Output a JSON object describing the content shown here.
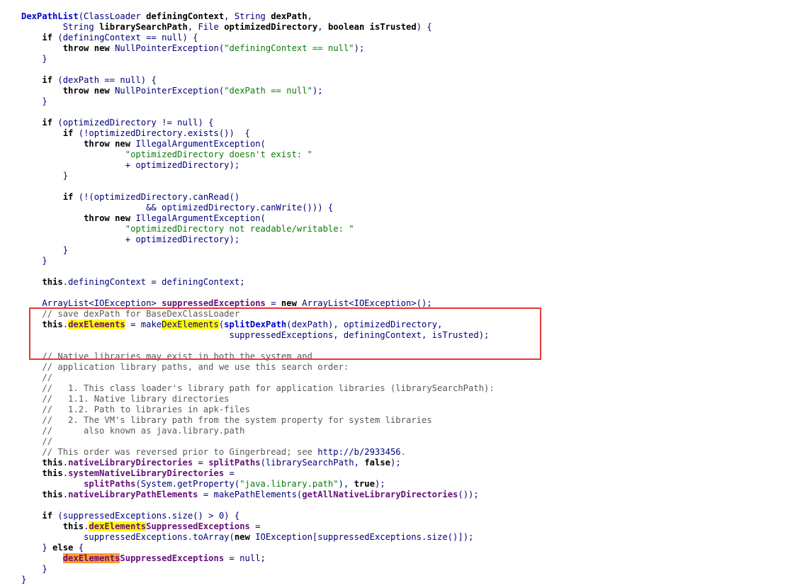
{
  "lines": [
    [
      {
        "t": "DexPathList",
        "c": "fn"
      },
      {
        "t": "(ClassLoader ",
        "c": "pl"
      },
      {
        "t": "definingContext",
        "c": "kw"
      },
      {
        "t": ", String ",
        "c": "pl"
      },
      {
        "t": "dexPath",
        "c": "kw"
      },
      {
        "t": ",",
        "c": "pl"
      }
    ],
    [
      {
        "t": "        String ",
        "c": "pl"
      },
      {
        "t": "librarySearchPath",
        "c": "kw"
      },
      {
        "t": ", File ",
        "c": "pl"
      },
      {
        "t": "optimizedDirectory",
        "c": "kw"
      },
      {
        "t": ", ",
        "c": "pl"
      },
      {
        "t": "boolean",
        "c": "kw"
      },
      {
        "t": " ",
        "c": "pl"
      },
      {
        "t": "isTrusted",
        "c": "kw"
      },
      {
        "t": ") {",
        "c": "pl"
      }
    ],
    [
      {
        "t": "    ",
        "c": "pl"
      },
      {
        "t": "if",
        "c": "kw"
      },
      {
        "t": " (definingContext == null) {",
        "c": "pl"
      }
    ],
    [
      {
        "t": "        ",
        "c": "pl"
      },
      {
        "t": "throw",
        "c": "kw"
      },
      {
        "t": " ",
        "c": "pl"
      },
      {
        "t": "new",
        "c": "kw"
      },
      {
        "t": " NullPointerException(",
        "c": "pl"
      },
      {
        "t": "\"definingContext == null\"",
        "c": "st"
      },
      {
        "t": ");",
        "c": "pl"
      }
    ],
    [
      {
        "t": "    }",
        "c": "pl"
      }
    ],
    [],
    [
      {
        "t": "    ",
        "c": "pl"
      },
      {
        "t": "if",
        "c": "kw"
      },
      {
        "t": " (dexPath == null) {",
        "c": "pl"
      }
    ],
    [
      {
        "t": "        ",
        "c": "pl"
      },
      {
        "t": "throw",
        "c": "kw"
      },
      {
        "t": " ",
        "c": "pl"
      },
      {
        "t": "new",
        "c": "kw"
      },
      {
        "t": " NullPointerException(",
        "c": "pl"
      },
      {
        "t": "\"dexPath == null\"",
        "c": "st"
      },
      {
        "t": ");",
        "c": "pl"
      }
    ],
    [
      {
        "t": "    }",
        "c": "pl"
      }
    ],
    [],
    [
      {
        "t": "    ",
        "c": "pl"
      },
      {
        "t": "if",
        "c": "kw"
      },
      {
        "t": " (optimizedDirectory != null) {",
        "c": "pl"
      }
    ],
    [
      {
        "t": "        ",
        "c": "pl"
      },
      {
        "t": "if",
        "c": "kw"
      },
      {
        "t": " (!optimizedDirectory.exists())  {",
        "c": "pl"
      }
    ],
    [
      {
        "t": "            ",
        "c": "pl"
      },
      {
        "t": "throw",
        "c": "kw"
      },
      {
        "t": " ",
        "c": "pl"
      },
      {
        "t": "new",
        "c": "kw"
      },
      {
        "t": " IllegalArgumentException(",
        "c": "pl"
      }
    ],
    [
      {
        "t": "                    ",
        "c": "pl"
      },
      {
        "t": "\"optimizedDirectory doesn't exist: \"",
        "c": "st"
      }
    ],
    [
      {
        "t": "                    + optimizedDirectory);",
        "c": "pl"
      }
    ],
    [
      {
        "t": "        }",
        "c": "pl"
      }
    ],
    [],
    [
      {
        "t": "        ",
        "c": "pl"
      },
      {
        "t": "if",
        "c": "kw"
      },
      {
        "t": " (!(optimizedDirectory.canRead()",
        "c": "pl"
      }
    ],
    [
      {
        "t": "                        && optimizedDirectory.canWrite())) {",
        "c": "pl"
      }
    ],
    [
      {
        "t": "            ",
        "c": "pl"
      },
      {
        "t": "throw",
        "c": "kw"
      },
      {
        "t": " ",
        "c": "pl"
      },
      {
        "t": "new",
        "c": "kw"
      },
      {
        "t": " IllegalArgumentException(",
        "c": "pl"
      }
    ],
    [
      {
        "t": "                    ",
        "c": "pl"
      },
      {
        "t": "\"optimizedDirectory not readable/writable: \"",
        "c": "st"
      }
    ],
    [
      {
        "t": "                    + optimizedDirectory);",
        "c": "pl"
      }
    ],
    [
      {
        "t": "        }",
        "c": "pl"
      }
    ],
    [
      {
        "t": "    }",
        "c": "pl"
      }
    ],
    [],
    [
      {
        "t": "    ",
        "c": "pl"
      },
      {
        "t": "this",
        "c": "kw"
      },
      {
        "t": ".definingContext = definingContext;",
        "c": "pl"
      }
    ],
    [],
    [
      {
        "t": "    ArrayList<IOException> ",
        "c": "pl"
      },
      {
        "t": "suppressedExceptions",
        "c": "fd"
      },
      {
        "t": " = ",
        "c": "pl"
      },
      {
        "t": "new",
        "c": "kw"
      },
      {
        "t": " ArrayList<IOException>();",
        "c": "pl"
      }
    ],
    [
      {
        "t": "    // save dexPath for BaseDexClassLoader",
        "c": "cm"
      }
    ],
    [
      {
        "t": "    ",
        "c": "pl"
      },
      {
        "t": "this",
        "c": "kw"
      },
      {
        "t": ".",
        "c": "pl"
      },
      {
        "t": "dexElements",
        "c": "fd",
        "h": "y"
      },
      {
        "t": " = make",
        "c": "pl"
      },
      {
        "t": "DexElements",
        "c": "pl",
        "h": "y"
      },
      {
        "t": "(",
        "c": "pl"
      },
      {
        "t": "splitDexPath",
        "c": "fn"
      },
      {
        "t": "(dexPath), optimizedDirectory,",
        "c": "pl"
      }
    ],
    [
      {
        "t": "                                        suppressedExceptions, definingContext, isTrusted);",
        "c": "pl"
      }
    ],
    [],
    [
      {
        "t": "    // Native libraries may exist in both the system and",
        "c": "cm"
      }
    ],
    [
      {
        "t": "    // application library paths, and we use this search order:",
        "c": "cm"
      }
    ],
    [
      {
        "t": "    //",
        "c": "cm"
      }
    ],
    [
      {
        "t": "    //   1. This class loader's library path for application libraries (librarySearchPath):",
        "c": "cm"
      }
    ],
    [
      {
        "t": "    //   1.1. Native library directories",
        "c": "cm"
      }
    ],
    [
      {
        "t": "    //   1.2. Path to libraries in apk-files",
        "c": "cm"
      }
    ],
    [
      {
        "t": "    //   2. The VM's library path from the system property for system libraries",
        "c": "cm"
      }
    ],
    [
      {
        "t": "    //      also known as java.library.path",
        "c": "cm"
      }
    ],
    [
      {
        "t": "    //",
        "c": "cm"
      }
    ],
    [
      {
        "t": "    // This order was reversed prior to Gingerbread; see ",
        "c": "cm"
      },
      {
        "t": "http://b/2933456",
        "c": "pl"
      },
      {
        "t": ".",
        "c": "cm"
      }
    ],
    [
      {
        "t": "    ",
        "c": "pl"
      },
      {
        "t": "this",
        "c": "kw"
      },
      {
        "t": ".",
        "c": "pl"
      },
      {
        "t": "nativeLibraryDirectories",
        "c": "fd"
      },
      {
        "t": " = ",
        "c": "pl"
      },
      {
        "t": "splitPaths",
        "c": "fd"
      },
      {
        "t": "(librarySearchPath, ",
        "c": "pl"
      },
      {
        "t": "false",
        "c": "kw"
      },
      {
        "t": ");",
        "c": "pl"
      }
    ],
    [
      {
        "t": "    ",
        "c": "pl"
      },
      {
        "t": "this",
        "c": "kw"
      },
      {
        "t": ".",
        "c": "pl"
      },
      {
        "t": "systemNativeLibraryDirectories",
        "c": "fd"
      },
      {
        "t": " =",
        "c": "pl"
      }
    ],
    [
      {
        "t": "            ",
        "c": "pl"
      },
      {
        "t": "splitPaths",
        "c": "fd"
      },
      {
        "t": "(System.getProperty(",
        "c": "pl"
      },
      {
        "t": "\"java.library.path\"",
        "c": "st"
      },
      {
        "t": "), ",
        "c": "pl"
      },
      {
        "t": "true",
        "c": "kw"
      },
      {
        "t": ");",
        "c": "pl"
      }
    ],
    [
      {
        "t": "    ",
        "c": "pl"
      },
      {
        "t": "this",
        "c": "kw"
      },
      {
        "t": ".",
        "c": "pl"
      },
      {
        "t": "nativeLibraryPathElements",
        "c": "fd"
      },
      {
        "t": " = makePathElements(",
        "c": "pl"
      },
      {
        "t": "getAllNativeLibraryDirectories",
        "c": "fd"
      },
      {
        "t": "());",
        "c": "pl"
      }
    ],
    [],
    [
      {
        "t": "    ",
        "c": "pl"
      },
      {
        "t": "if",
        "c": "kw"
      },
      {
        "t": " (suppressedExceptions.size() > 0) {",
        "c": "pl"
      }
    ],
    [
      {
        "t": "        ",
        "c": "pl"
      },
      {
        "t": "this",
        "c": "kw"
      },
      {
        "t": ".",
        "c": "pl"
      },
      {
        "t": "dexElements",
        "c": "fd",
        "h": "y"
      },
      {
        "t": "SuppressedExceptions",
        "c": "fd"
      },
      {
        "t": " =",
        "c": "pl"
      }
    ],
    [
      {
        "t": "            suppressedExceptions.toArray(",
        "c": "pl"
      },
      {
        "t": "new",
        "c": "kw"
      },
      {
        "t": " IOException[suppressedExceptions.size()]);",
        "c": "pl"
      }
    ],
    [
      {
        "t": "    } ",
        "c": "pl"
      },
      {
        "t": "else",
        "c": "kw"
      },
      {
        "t": " {",
        "c": "pl"
      }
    ],
    [
      {
        "t": "        ",
        "c": "pl"
      },
      {
        "t": "dexElements",
        "c": "fd",
        "h": "o"
      },
      {
        "t": "SuppressedExceptions",
        "c": "fd"
      },
      {
        "t": " = null;",
        "c": "pl"
      }
    ],
    [
      {
        "t": "    }",
        "c": "pl"
      }
    ],
    [
      {
        "t": "}",
        "c": "pl"
      }
    ]
  ]
}
